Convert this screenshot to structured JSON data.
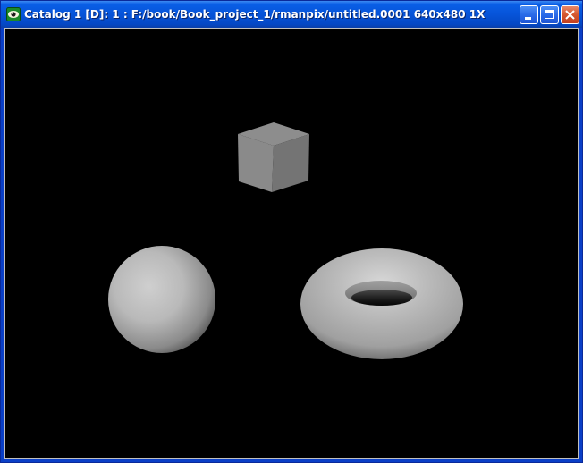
{
  "window": {
    "title": "Catalog 1 [D]: 1 : F:/book/Book_project_1/rmanpix/untitled.0001  640x480  1X",
    "app_icon": "eye-icon",
    "controls": {
      "minimize": "minimize-icon",
      "maximize": "maximize-icon",
      "close": "close-icon"
    }
  },
  "colors": {
    "titlebar": "#0654d9",
    "close_button": "#d5572f",
    "canvas_background": "#000000"
  }
}
